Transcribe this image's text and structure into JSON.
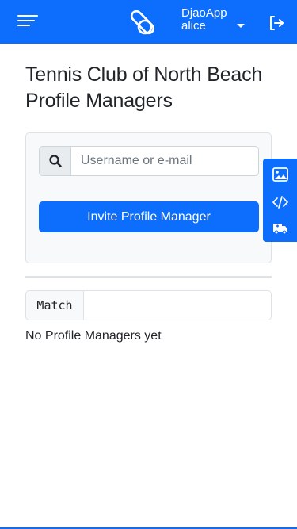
{
  "header": {
    "app_name": "DjaoApp",
    "username": "alice",
    "menu_icon": "hamburger-menu-icon",
    "logo_icon": "djaoapp-logo-icon",
    "logout_icon": "logout-icon"
  },
  "page": {
    "title": "Tennis Club of North Beach Profile Managers"
  },
  "invite_card": {
    "search_placeholder": "Username or e-mail",
    "search_value": "",
    "invite_button_label": "Invite Profile Manager"
  },
  "filter": {
    "match_label": "Match",
    "match_value": ""
  },
  "list": {
    "empty_message": "No Profile Managers yet"
  },
  "side_tools": [
    {
      "icon": "image-icon"
    },
    {
      "icon": "code-icon"
    },
    {
      "icon": "ambulance-icon"
    }
  ],
  "colors": {
    "primary": "#0d6efd",
    "card_bg": "#f8f9fa",
    "border": "#dee2e6"
  }
}
